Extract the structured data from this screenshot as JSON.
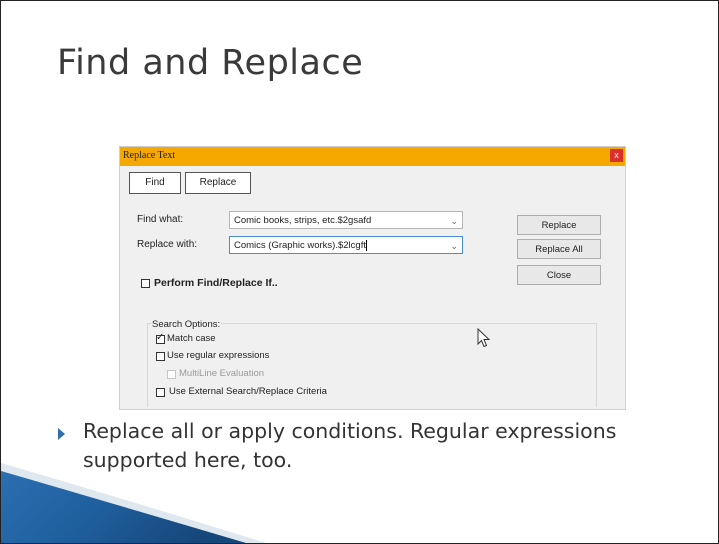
{
  "slide": {
    "title": "Find and Replace",
    "bullet": "Replace all or apply conditions.  Regular expressions supported here, too."
  },
  "dialog": {
    "title": "Replace Text",
    "close_glyph": "x",
    "tabs": [
      {
        "label": "Find"
      },
      {
        "label": "Replace"
      }
    ],
    "find_what": {
      "label": "Find what:",
      "value": "Comic books, strips, etc.$2gsafd"
    },
    "replace_with": {
      "label": "Replace with:",
      "value": "Comics (Graphic works).$2lcgft"
    },
    "buttons": {
      "replace": "Replace",
      "replace_all": "Replace All",
      "close": "Close"
    },
    "perform_if": {
      "label": "Perform Find/Replace If..",
      "checked": false
    },
    "search_options": {
      "title": "Search Options:",
      "items": [
        {
          "label": "Match case",
          "checked": true,
          "enabled": true
        },
        {
          "label": "Use regular expressions",
          "checked": false,
          "enabled": true
        },
        {
          "label": "MultiLine Evaluation",
          "checked": false,
          "enabled": false
        },
        {
          "label": "Use External Search/Replace Criteria",
          "checked": false,
          "enabled": true
        }
      ]
    }
  },
  "colors": {
    "titlebar": "#f5a800",
    "close_button": "#d9302b",
    "bullet": "#2f6fad",
    "corner": "#1f5f9e"
  }
}
